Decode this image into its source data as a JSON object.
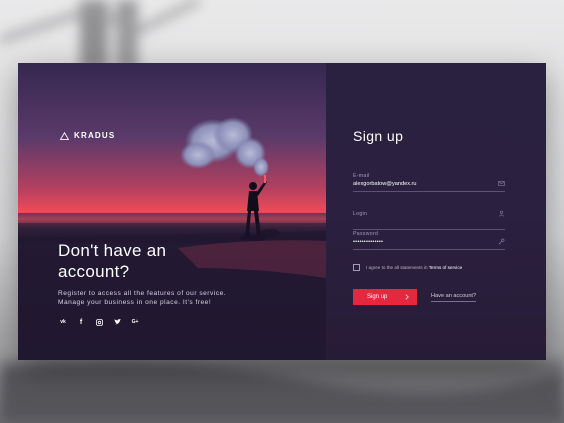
{
  "brand": {
    "name": "KRADUS"
  },
  "hero": {
    "headline_line1": "Don't have an",
    "headline_line2": "account?",
    "desc_line1": "Register to access all the features of our service.",
    "desc_line2": "Manage your business in one place. It's free!"
  },
  "social": {
    "vk": "vk",
    "facebook": "f",
    "instagram": "instagram-icon",
    "twitter": "twitter-icon",
    "google": "G+"
  },
  "form": {
    "title": "Sign up",
    "email_label": "E-mail",
    "email_value": "alexgorbatow@yandex.ru",
    "login_label": "Login",
    "login_value": "",
    "password_label": "Password",
    "password_value": "••••••••••••••",
    "terms_prefix": "I agree to the all statements in ",
    "terms_link": "Terms of service",
    "submit_label": "Sign up",
    "have_account": "Have an account?"
  },
  "colors": {
    "accent": "#e6283f",
    "panel": "#2a2040"
  }
}
